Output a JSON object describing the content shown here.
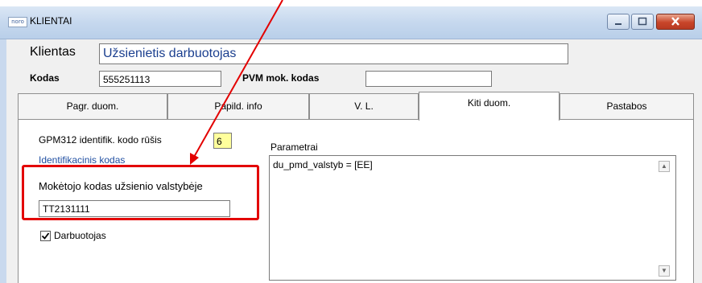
{
  "window": {
    "app_logo": "noro",
    "title": "KLIENTAI",
    "controls": [
      "minimize-icon",
      "maximize-icon",
      "close-icon"
    ]
  },
  "client": {
    "label": "Klientas",
    "name_value": "Užsienietis darbuotojas",
    "code_label": "Kodas",
    "code_value": "555251113",
    "vat_label": "PVM mok. kodas",
    "vat_value": ""
  },
  "tabs": [
    {
      "label": "Pagr. duom."
    },
    {
      "label": "Papild. info"
    },
    {
      "label": "V. L."
    },
    {
      "label": "Kiti duom."
    },
    {
      "label": "Pastabos"
    }
  ],
  "active_tab": "Kiti duom.",
  "panel": {
    "gpm_label": "GPM312 identifik. kodo rūšis",
    "gpm_value": "6",
    "link_label": "Identifikacinis kodas",
    "foreign_code_label": "Mokėtojo kodas užsienio valstybėje",
    "foreign_code_value": "TT2131111",
    "employee_label": "Darbuotojas",
    "employee_checked": true,
    "params_label": "Parametrai",
    "params_value": "du_pmd_valstyb = [EE]"
  },
  "colors": {
    "highlight": "#e30000",
    "title_bar": "#c6d8ee",
    "link": "#1f4ea1",
    "field_highlight": "#ffff9c"
  }
}
